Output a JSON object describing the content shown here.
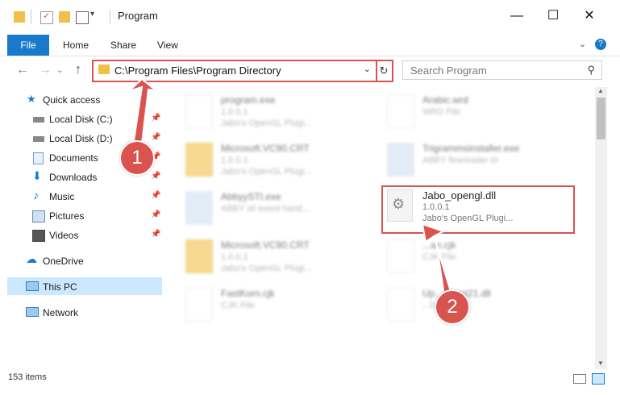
{
  "window": {
    "title": "Program"
  },
  "ribbon": {
    "file": "File",
    "tabs": [
      "Home",
      "Share",
      "View"
    ]
  },
  "address": {
    "path": "C:\\Program Files\\Program Directory"
  },
  "search": {
    "placeholder": "Search Program"
  },
  "sidebar": {
    "items": [
      {
        "label": "Quick access",
        "icon": "star-icon"
      },
      {
        "label": "Local Disk (C:)",
        "icon": "drive-icon",
        "pinned": true
      },
      {
        "label": "Local Disk (D:)",
        "icon": "drive-icon",
        "pinned": true
      },
      {
        "label": "Documents",
        "icon": "documents-icon",
        "pinned": true
      },
      {
        "label": "Downloads",
        "icon": "download-icon",
        "pinned": true
      },
      {
        "label": "Music",
        "icon": "music-icon",
        "pinned": true
      },
      {
        "label": "Pictures",
        "icon": "pictures-icon",
        "pinned": true
      },
      {
        "label": "Videos",
        "icon": "videos-icon",
        "pinned": true
      },
      {
        "label": "OneDrive",
        "icon": "cloud-icon"
      },
      {
        "label": "This PC",
        "icon": "computer-icon",
        "selected": true
      },
      {
        "label": "Network",
        "icon": "network-icon"
      }
    ]
  },
  "files": [
    {
      "name": "program.exe",
      "line2": "1.0.0.1",
      "line3": "Jabo's OpenGL Plugi..."
    },
    {
      "name": "Arabic.wrd",
      "line2": "WRD File",
      "line3": ""
    },
    {
      "name": "Microsoft.VC90.CRT",
      "line2": "1.0.0.1",
      "line3": "Jabo's OpenGL Plugi..."
    },
    {
      "name": "Trigrammsinstaller.exe",
      "line2": "ABBY finereader tri",
      "line3": ""
    },
    {
      "name": "AbbyySTI.exe",
      "line2": "ABBY sti event hand...",
      "line3": ""
    },
    {
      "name": "Jabo_opengl.dll",
      "line2": "1.0.0.1",
      "line3": "Jabo's OpenGL Plugi..."
    },
    {
      "name": "Microsoft.VC90.CRT",
      "line2": "1.0.0.1",
      "line3": "Jabo's OpenGL Plugi..."
    },
    {
      "name": "...an.cjk",
      "line2": "CJK File",
      "line3": ""
    },
    {
      "name": "FastKorn.cjk",
      "line2": "CJK File",
      "line3": ""
    },
    {
      "name": "Up...Client21.dll",
      "line2": "...DLL",
      "line3": ""
    }
  ],
  "status": {
    "count": "153 items"
  },
  "annotations": {
    "badge1": "1",
    "badge2": "2",
    "color": "#d9534f"
  }
}
